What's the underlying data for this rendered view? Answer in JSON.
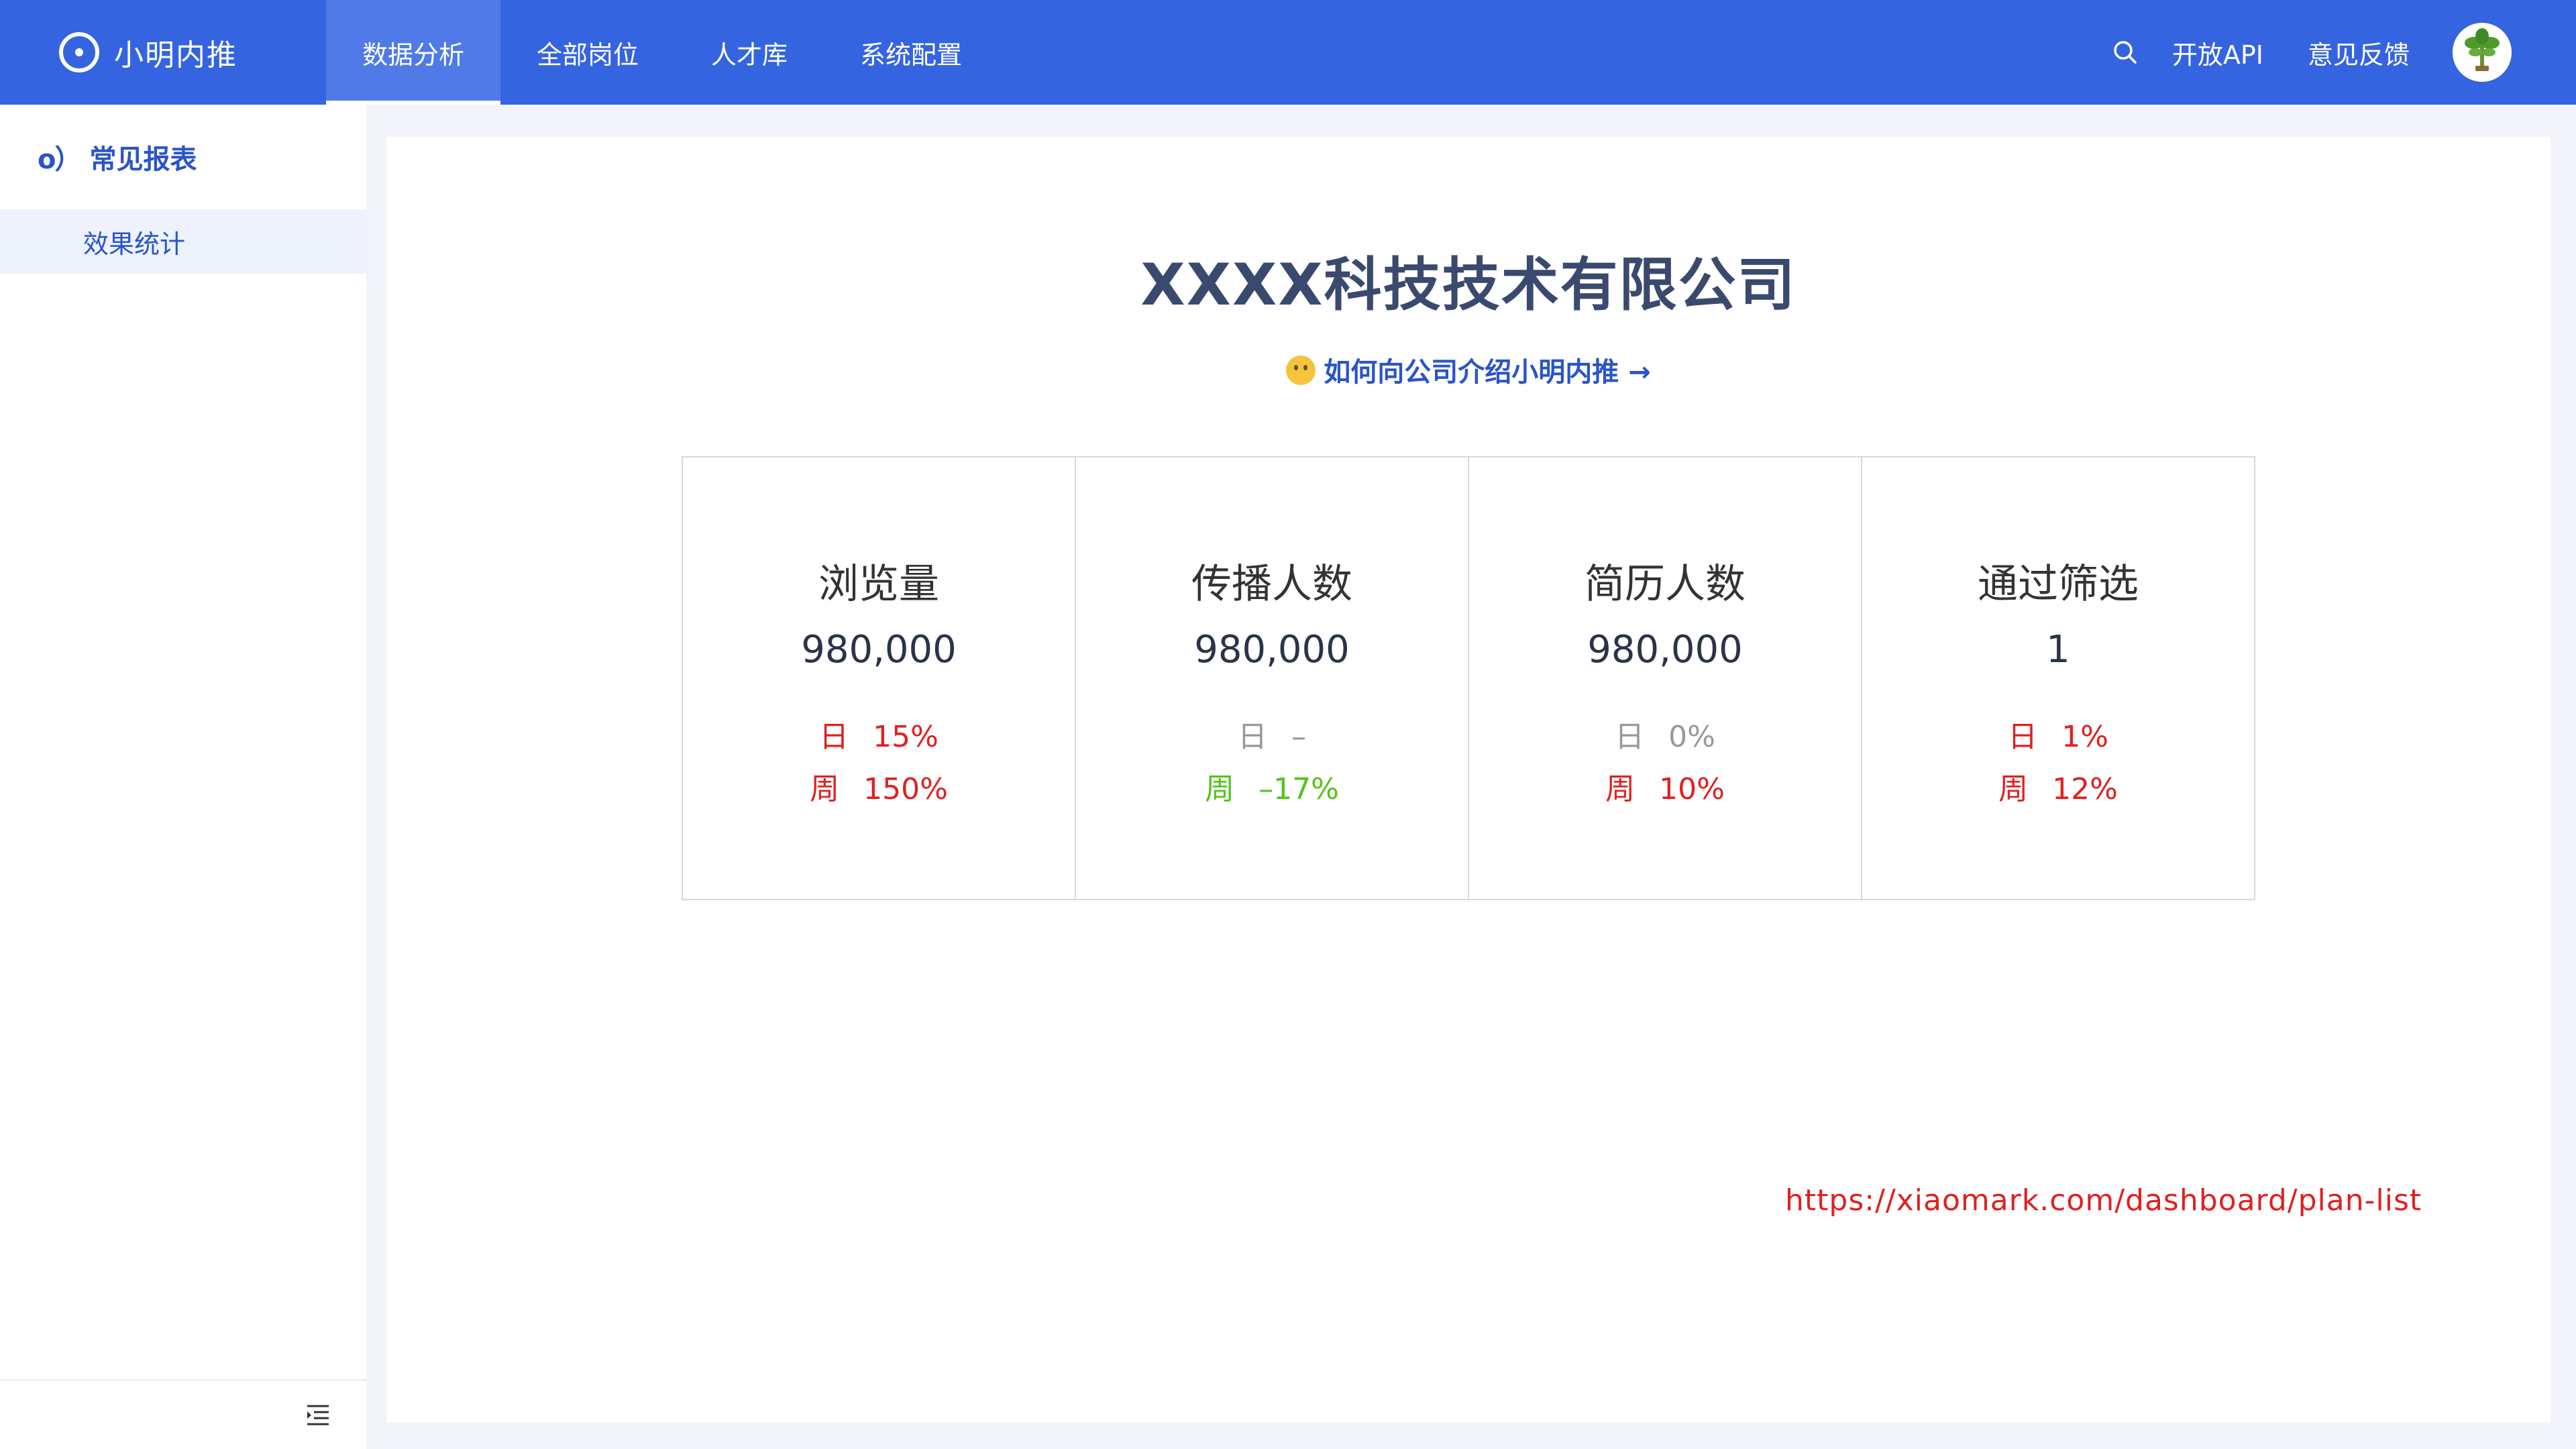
{
  "app": {
    "name": "小明内推"
  },
  "nav": {
    "tabs": [
      "数据分析",
      "全部岗位",
      "人才库",
      "系统配置"
    ],
    "active_tab": "数据分析",
    "links": [
      "开放API",
      "意见反馈"
    ]
  },
  "sidebar": {
    "group_icon": "o）",
    "group_label": "常见报表",
    "items": [
      "效果统计"
    ]
  },
  "main": {
    "company": "XXXX科技技术有限公司",
    "intro_link": "如何向公司介绍小明内推 →",
    "note_url": "https://xiaomark.com/dashboard/plan-list"
  },
  "stats": [
    {
      "label": "浏览量",
      "value": "980,000",
      "day_label": "日",
      "day": "15%",
      "day_color": "#e02020",
      "week_label": "周",
      "week": "150%",
      "week_color": "#e02020"
    },
    {
      "label": "传播人数",
      "value": "980,000",
      "day_label": "日",
      "day": "–",
      "day_color": "#999999",
      "week_label": "周",
      "week": "–17%",
      "week_color": "#52c41a"
    },
    {
      "label": "简历人数",
      "value": "980,000",
      "day_label": "日",
      "day": "0%",
      "day_color": "#999999",
      "week_label": "周",
      "week": "10%",
      "week_color": "#e02020"
    },
    {
      "label": "通过筛选",
      "value": "1",
      "day_label": "日",
      "day": "1%",
      "day_color": "#e02020",
      "week_label": "周",
      "week": "12%",
      "week_color": "#e02020"
    }
  ],
  "colors": {
    "brand_blue": "#3564e0",
    "active_tab": "#4f7ae7",
    "link_blue": "#2a55c8",
    "up_red": "#e02020",
    "down_green": "#52c41a",
    "neutral_gray": "#999999"
  },
  "icons": {
    "brand": "circle-dot-logo-icon",
    "search": "search-icon",
    "avatar": "plant-avatar",
    "collapse": "menu-collapse-icon",
    "intro": "thinking-face-emoji"
  }
}
